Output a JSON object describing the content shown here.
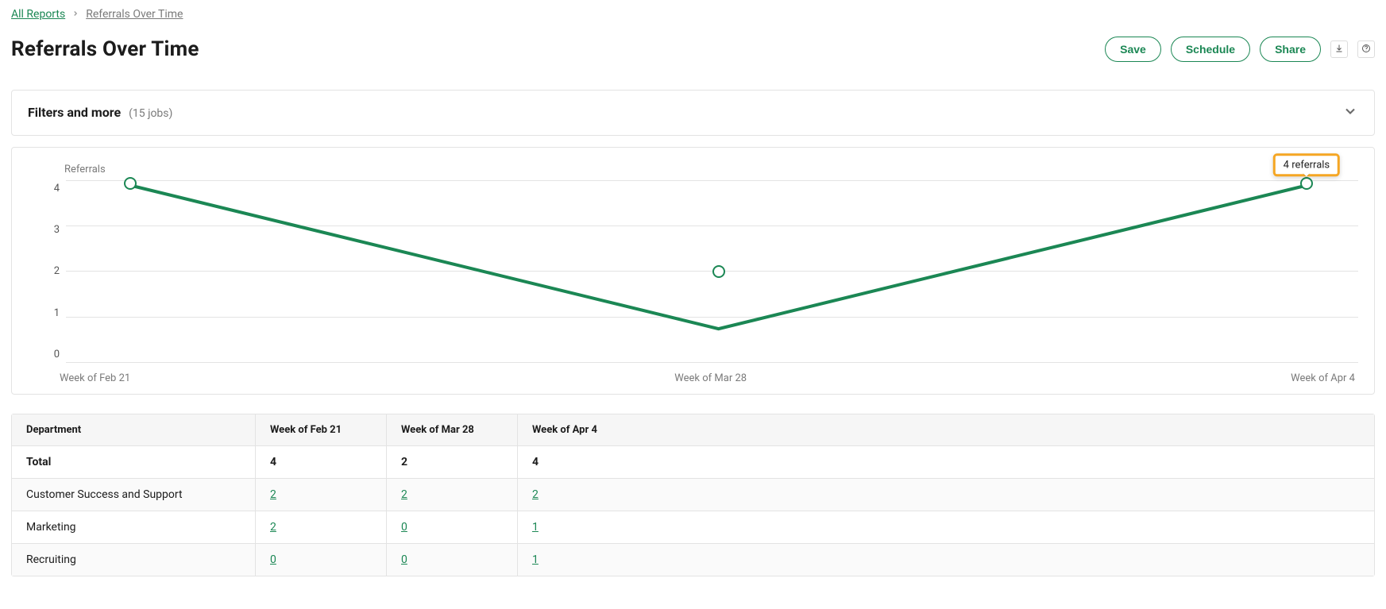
{
  "breadcrumb": {
    "root": "All Reports",
    "current": "Referrals Over Time"
  },
  "page_title": "Referrals Over Time",
  "actions": {
    "save": "Save",
    "schedule": "Schedule",
    "share": "Share"
  },
  "filters": {
    "label": "Filters and more",
    "count": "(15 jobs)"
  },
  "chart_data": {
    "type": "line",
    "title": "Referrals",
    "ylabel": "",
    "xlabel": "",
    "ylim": [
      0,
      4
    ],
    "yticks": [
      4,
      3,
      2,
      1,
      0
    ],
    "categories": [
      "Week of Feb 21",
      "Week of Mar 28",
      "Week of Apr 4"
    ],
    "values": [
      4,
      2,
      4
    ],
    "tooltip": "4 referrals",
    "tooltip_index": 2
  },
  "table": {
    "columns": [
      "Department",
      "Week of Feb 21",
      "Week of Mar 28",
      "Week of Apr 4"
    ],
    "total_row": {
      "label": "Total",
      "values": [
        "4",
        "2",
        "4"
      ]
    },
    "rows": [
      {
        "label": "Customer Success and Support",
        "values": [
          "2",
          "2",
          "2"
        ]
      },
      {
        "label": "Marketing",
        "values": [
          "2",
          "0",
          "1"
        ]
      },
      {
        "label": "Recruiting",
        "values": [
          "0",
          "0",
          "1"
        ]
      }
    ]
  }
}
